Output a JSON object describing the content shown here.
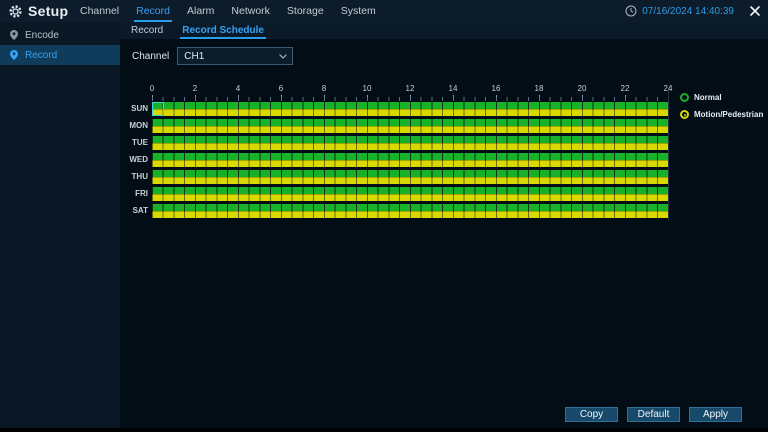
{
  "app": {
    "title": "Setup",
    "datetime": "07/16/2024 14:40:39"
  },
  "menu": {
    "items": [
      {
        "label": "Channel",
        "active": false
      },
      {
        "label": "Record",
        "active": true
      },
      {
        "label": "Alarm",
        "active": false
      },
      {
        "label": "Network",
        "active": false
      },
      {
        "label": "Storage",
        "active": false
      },
      {
        "label": "System",
        "active": false
      }
    ]
  },
  "sidebar": {
    "items": [
      {
        "label": "Encode",
        "active": false
      },
      {
        "label": "Record",
        "active": true
      }
    ]
  },
  "tabs": {
    "items": [
      {
        "label": "Record",
        "active": false
      },
      {
        "label": "Record Schedule",
        "active": true
      }
    ]
  },
  "channel": {
    "label": "Channel",
    "value": "CH1"
  },
  "schedule": {
    "hour_labels": [
      "0",
      "2",
      "4",
      "6",
      "8",
      "10",
      "12",
      "14",
      "16",
      "18",
      "20",
      "22",
      "24"
    ],
    "days": [
      "SUN",
      "MON",
      "TUE",
      "WED",
      "THU",
      "FRI",
      "SAT"
    ],
    "hours_range": [
      0,
      24
    ],
    "cells_per_day": 48,
    "cell_minutes": 30,
    "rows": [
      {
        "day": "SUN",
        "normal": "00:00-24:00",
        "motion_pedestrian": "00:00-24:00"
      },
      {
        "day": "MON",
        "normal": "00:00-24:00",
        "motion_pedestrian": "00:00-24:00"
      },
      {
        "day": "TUE",
        "normal": "00:00-24:00",
        "motion_pedestrian": "00:00-24:00"
      },
      {
        "day": "WED",
        "normal": "00:00-24:00",
        "motion_pedestrian": "00:00-24:00"
      },
      {
        "day": "THU",
        "normal": "00:00-24:00",
        "motion_pedestrian": "00:00-24:00"
      },
      {
        "day": "FRI",
        "normal": "00:00-24:00",
        "motion_pedestrian": "00:00-24:00"
      },
      {
        "day": "SAT",
        "normal": "00:00-24:00",
        "motion_pedestrian": "00:00-24:00"
      }
    ],
    "legend": [
      {
        "label": "Normal",
        "color": "#17b22a"
      },
      {
        "label": "Motion/Pedestrian",
        "color": "#d9d900"
      }
    ],
    "selection": {
      "day": "SUN",
      "cell_index": 0
    }
  },
  "footer": {
    "buttons": [
      "Copy",
      "Default",
      "Apply"
    ]
  },
  "colors": {
    "accent_blue": "#36a3f7",
    "normal_green": "#17b22a",
    "motion_yellow": "#d9d900",
    "selection_cyan": "#3fd6d6",
    "topbar_bg": "#0d1c2a",
    "sidebar_selected_bg": "#0e3c5a",
    "button_bg": "#17496b"
  }
}
